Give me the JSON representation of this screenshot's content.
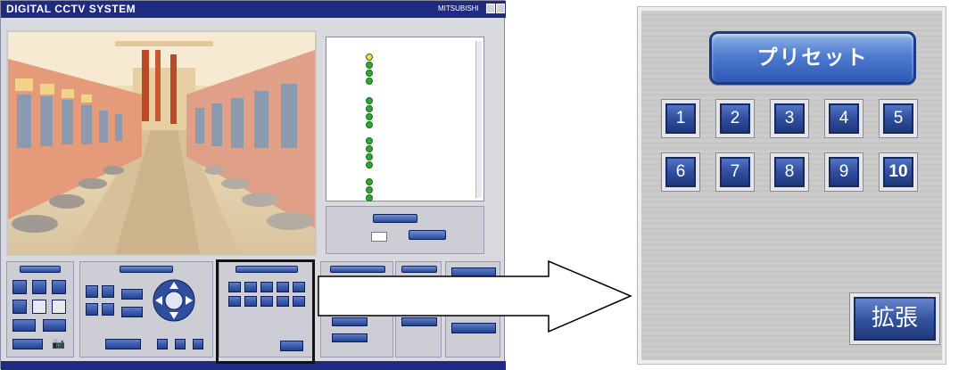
{
  "window": {
    "title": "DIGITAL CCTV SYSTEM",
    "brand": "MITSUBISHI"
  },
  "preset_panel": {
    "title": "プリセット",
    "buttons": [
      "1",
      "2",
      "3",
      "4",
      "5",
      "6",
      "7",
      "8",
      "9",
      "10"
    ],
    "expand_label": "拡張"
  },
  "colors": {
    "titlebar": "#1f2b80",
    "button_blue": "#2f4f9e",
    "highlight_border": "#111111"
  },
  "icons": [
    "window-minimize-icon",
    "window-close-icon",
    "camera-icon",
    "ptz-joystick-icon",
    "right-arrow-icon"
  ]
}
